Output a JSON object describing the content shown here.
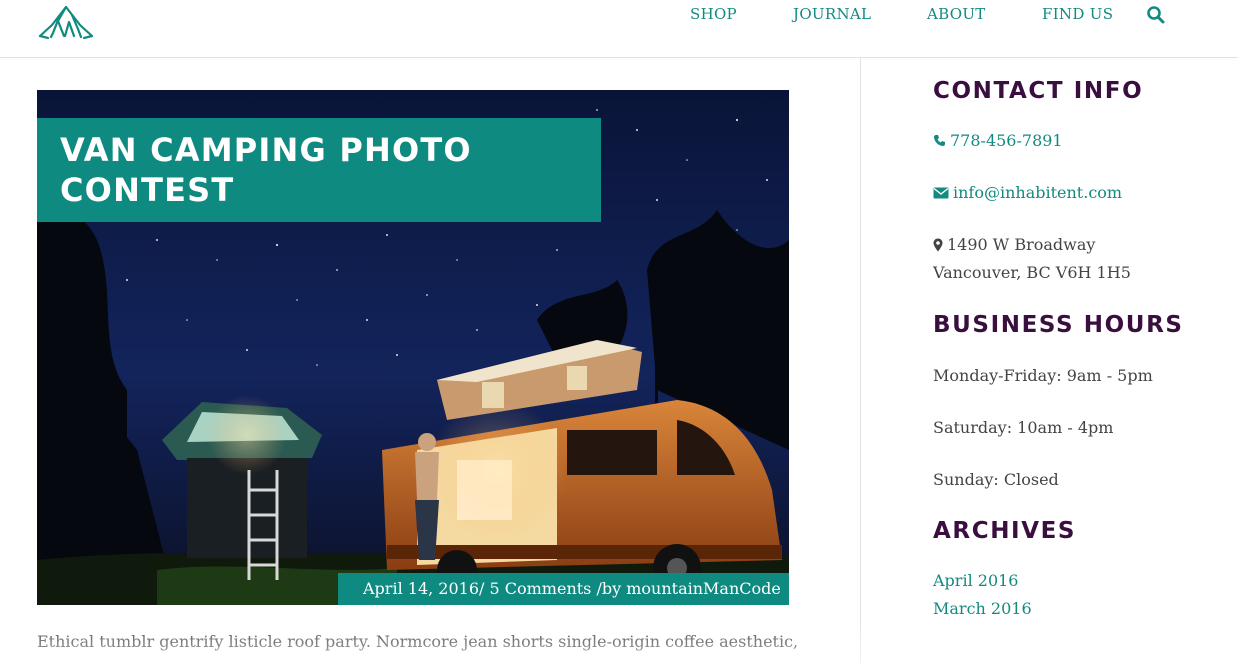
{
  "nav": {
    "shop": "SHOP",
    "journal": "JOURNAL",
    "about": "ABOUT",
    "find_us": "FIND US"
  },
  "icons": {
    "logo": "tent-logo-icon",
    "search": "search-icon",
    "phone": "phone-icon",
    "email": "envelope-icon",
    "address": "map-marker-icon"
  },
  "colors": {
    "accent": "#0e8a80",
    "link": "#138a7f",
    "heading": "#3a0f3f"
  },
  "post": {
    "title": "VAN CAMPING PHOTO CONTEST",
    "date": "April 14, 2016/",
    "comments": " 5 Comments ",
    "author": "/by mountainManCode",
    "excerpt": "Ethical tumblr gentrify listicle roof party. Normcore jean shorts single-origin coffee aesthetic,"
  },
  "sidebar": {
    "contact": {
      "title": "CONTACT INFO",
      "phone": "778-456-7891",
      "email": "info@inhabitent.com",
      "address_line1": "1490 W Broadway",
      "address_line2": "Vancouver, BC V6H 1H5"
    },
    "hours": {
      "title": "BUSINESS HOURS",
      "weekdays": "Monday-Friday: 9am - 5pm",
      "saturday": "Saturday: 10am - 4pm",
      "sunday": "Sunday: Closed"
    },
    "archives": {
      "title": "ARCHIVES",
      "items": [
        "April 2016",
        "March 2016"
      ]
    }
  }
}
